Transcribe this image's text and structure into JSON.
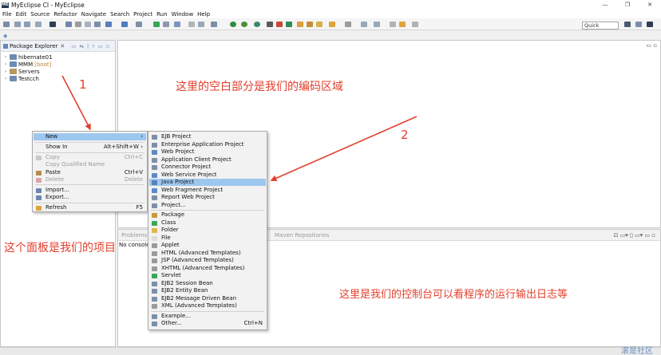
{
  "window": {
    "title": "MyEclipse CI - MyEclipse",
    "logo_text": "ME",
    "controls": [
      "—",
      "❐",
      "✕"
    ]
  },
  "menubar": [
    "File",
    "Edit",
    "Source",
    "Refactor",
    "Navigate",
    "Search",
    "Project",
    "Run",
    "Window",
    "Help"
  ],
  "toolbar": {
    "quick_access": "Quick Access"
  },
  "package_explorer": {
    "title": "Package Explorer",
    "close_glyph": "✕",
    "toolbar_glyphs": "▭ ⇆ | ▿ ▭ ▫",
    "items": [
      {
        "label": "hibernate01",
        "tag": ""
      },
      {
        "label": "MMM",
        "tag": "[boot]"
      },
      {
        "label": "Servers",
        "tag": ""
      },
      {
        "label": "Testcch",
        "tag": ""
      }
    ]
  },
  "editor": {
    "controls": "▭ ▫"
  },
  "console": {
    "tab_problems": "Problems",
    "tab_maven": "Maven Repositories",
    "message": "No consoles",
    "controls": "⊡ ▭▾ ▯ ▭▾ ▭ ▫"
  },
  "context_menu": [
    {
      "label": "New",
      "shortcut": "›",
      "disabled": false,
      "highlight": true,
      "icon": ""
    },
    {
      "label": "Show In",
      "shortcut": "Alt+Shift+W ›",
      "disabled": false,
      "highlight": false,
      "icon": ""
    },
    {
      "label": "Copy",
      "shortcut": "Ctrl+C",
      "disabled": true,
      "highlight": false,
      "icon": "#c9c9c9"
    },
    {
      "label": "Copy Qualified Name",
      "shortcut": "",
      "disabled": true,
      "highlight": false,
      "icon": ""
    },
    {
      "label": "Paste",
      "shortcut": "Ctrl+V",
      "disabled": false,
      "highlight": false,
      "icon": "#b58c4d"
    },
    {
      "label": "Delete",
      "shortcut": "Delete",
      "disabled": true,
      "highlight": false,
      "icon": "#d9a3a3"
    },
    {
      "label": "Import...",
      "shortcut": "",
      "disabled": false,
      "highlight": false,
      "icon": "#6b86b0"
    },
    {
      "label": "Export...",
      "shortcut": "",
      "disabled": false,
      "highlight": false,
      "icon": "#6b86b0"
    },
    {
      "label": "Refresh",
      "shortcut": "F5",
      "disabled": false,
      "highlight": false,
      "icon": "#e0a43a"
    }
  ],
  "new_submenu": [
    {
      "label": "EJB Project",
      "icon": "#7d8fa8",
      "highlight": false
    },
    {
      "label": "Enterprise Application Project",
      "icon": "#7d8fa8",
      "highlight": false
    },
    {
      "label": "Web Project",
      "icon": "#5c8ac6",
      "highlight": false
    },
    {
      "label": "Application Client Project",
      "icon": "#7d8fa8",
      "highlight": false
    },
    {
      "label": "Connector Project",
      "icon": "#7d8fa8",
      "highlight": false
    },
    {
      "label": "Web Service Project",
      "icon": "#5c8ac6",
      "highlight": false
    },
    {
      "label": "Java Project",
      "icon": "#5a7fb8",
      "highlight": true
    },
    {
      "label": "Web Fragment Project",
      "icon": "#5c8ac6",
      "highlight": false
    },
    {
      "label": "Report Web Project",
      "icon": "#7d8fa8",
      "highlight": false
    },
    {
      "label": "Project...",
      "icon": "#7d8fa8",
      "highlight": false
    },
    {
      "label": "Package",
      "icon": "#c79a3a",
      "highlight": false
    },
    {
      "label": "Class",
      "icon": "#3aa55a",
      "highlight": false
    },
    {
      "label": "Folder",
      "icon": "#e0b74a",
      "highlight": false
    },
    {
      "label": "File",
      "icon": "#dcdcdc",
      "highlight": false
    },
    {
      "label": "Applet",
      "icon": "#9a9a9a",
      "highlight": false
    },
    {
      "label": "HTML (Advanced Templates)",
      "icon": "#9a9a9a",
      "highlight": false
    },
    {
      "label": "JSP (Advanced Templates)",
      "icon": "#9a9a9a",
      "highlight": false
    },
    {
      "label": "XHTML (Advanced Templates)",
      "icon": "#9a9a9a",
      "highlight": false
    },
    {
      "label": "Servlet",
      "icon": "#3aa55a",
      "highlight": false
    },
    {
      "label": "EJB2 Session Bean",
      "icon": "#7d8fa8",
      "highlight": false
    },
    {
      "label": "EJB2 Entity Bean",
      "icon": "#7d8fa8",
      "highlight": false
    },
    {
      "label": "EJB2 Message Driven Bean",
      "icon": "#7d8fa8",
      "highlight": false
    },
    {
      "label": "XML (Advanced Templates)",
      "icon": "#9a9a9a",
      "highlight": false
    },
    {
      "label": "Example...",
      "icon": "#7d8fa8",
      "highlight": false
    },
    {
      "label": "Other...",
      "icon": "#7d8fa8",
      "highlight": false,
      "shortcut": "Ctrl+N"
    }
  ],
  "annotations": {
    "editor_note": "这里的空白部分是我们的编码区域",
    "panel_note": "这个面板是我们的项目",
    "console_note": "这里是我们的控制台可以看程序的运行输出日志等",
    "marker_1": "1",
    "marker_2": "2",
    "watermark": "滚是社区"
  },
  "colors": {
    "annotation": "#e2402e",
    "highlight": "#9dc7ef",
    "menu_bg": "#f2f2f2"
  }
}
